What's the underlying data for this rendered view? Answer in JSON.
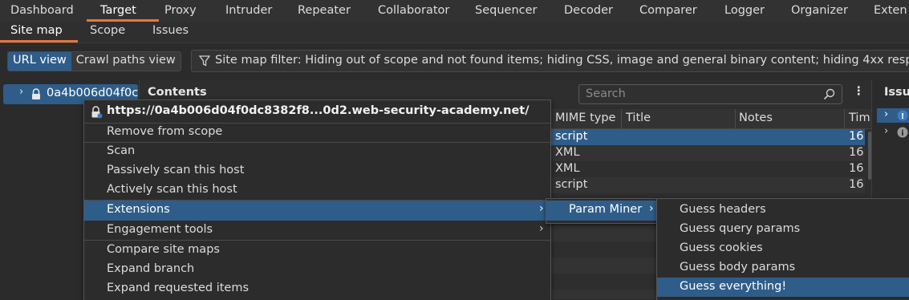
{
  "top_tabs": [
    "Dashboard",
    "Target",
    "Proxy",
    "Intruder",
    "Repeater",
    "Collaborator",
    "Sequencer",
    "Decoder",
    "Comparer",
    "Logger",
    "Organizer",
    "Exten"
  ],
  "sub_tabs": [
    "Site map",
    "Scope",
    "Issues"
  ],
  "view_toggle": {
    "url_view": "URL view",
    "crawl_view": "Crawl paths view"
  },
  "filter_text": "Site map filter: Hiding out of scope and not found items; hiding CSS, image and general binary content; hiding 4xx resp",
  "tree": {
    "host": "0a4b006d04f0c"
  },
  "contents": {
    "title": "Contents",
    "search_placeholder": "Search",
    "columns": [
      "MIME type",
      "Title",
      "Notes",
      "Tim"
    ],
    "rows": [
      {
        "mime": "script",
        "time": "16"
      },
      {
        "mime": "XML",
        "time": "16"
      },
      {
        "mime": "XML",
        "time": "16"
      },
      {
        "mime": "script",
        "time": "16"
      }
    ]
  },
  "issues_title": "Issu",
  "context_menu": {
    "header_url": "https://0a4b006d04f0dc8382f8...0d2.web-security-academy.net/",
    "items": [
      "Remove from scope",
      "Scan",
      "Passively scan this host",
      "Actively scan this host",
      "Extensions",
      "Engagement tools",
      "Compare site maps",
      "Expand branch",
      "Expand requested items"
    ]
  },
  "extensions_menu": {
    "items": [
      "Param Miner"
    ]
  },
  "param_miner_menu": {
    "items": [
      "Guess headers",
      "Guess query params",
      "Guess cookies",
      "Guess body params",
      "Guess everything!"
    ]
  },
  "colors": {
    "accent": "#e8763a",
    "selection": "#2f5d8a",
    "background": "#2b2b2b"
  }
}
